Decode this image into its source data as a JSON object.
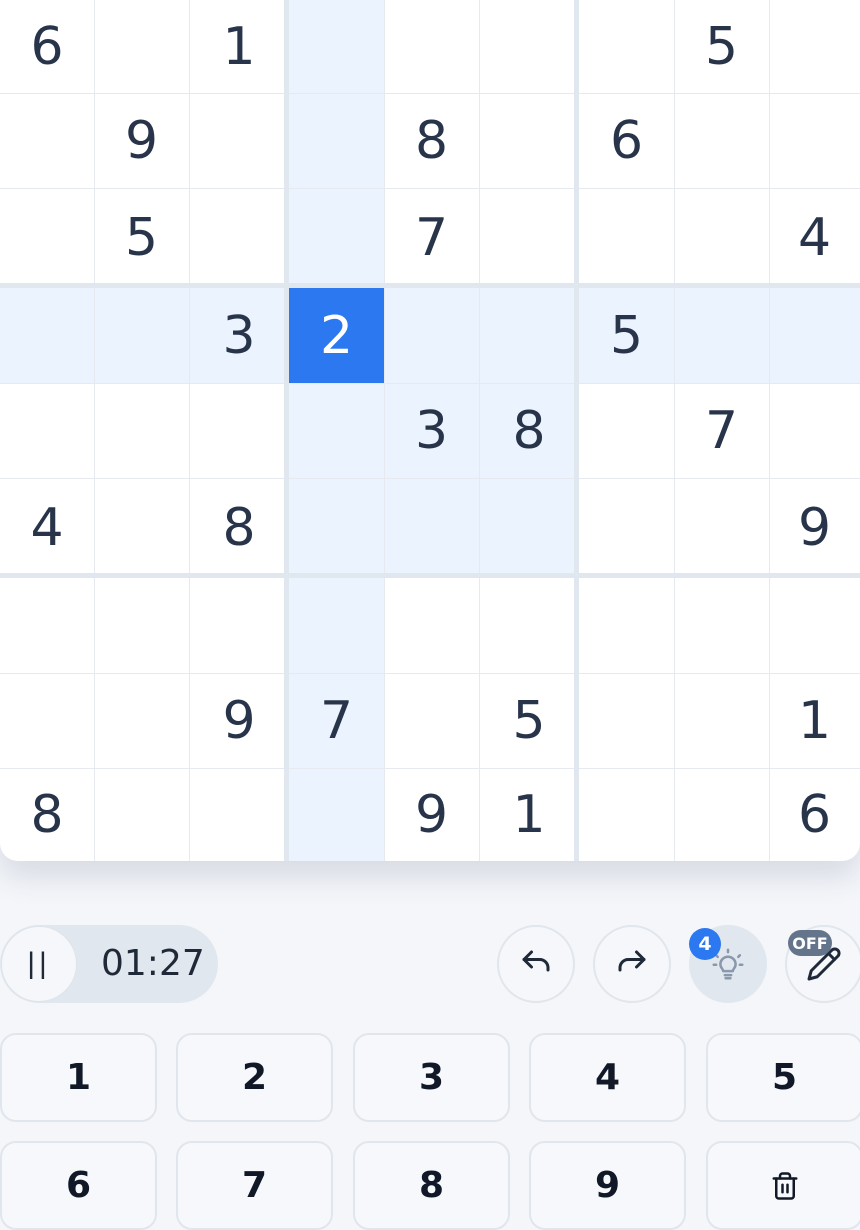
{
  "board": {
    "cells": [
      [
        "6",
        "",
        "1",
        "",
        "",
        "",
        "",
        "5",
        ""
      ],
      [
        "",
        "9",
        "",
        "",
        "8",
        "",
        "6",
        "",
        ""
      ],
      [
        "",
        "5",
        "",
        "",
        "7",
        "",
        "",
        "",
        "4"
      ],
      [
        "",
        "",
        "3",
        "2",
        "",
        "",
        "5",
        "",
        ""
      ],
      [
        "",
        "",
        "",
        "",
        "3",
        "8",
        "",
        "7",
        ""
      ],
      [
        "4",
        "",
        "8",
        "",
        "",
        "",
        "",
        "",
        "9"
      ],
      [
        "",
        "",
        "",
        "",
        "",
        "",
        "",
        "",
        ""
      ],
      [
        "",
        "",
        "9",
        "7",
        "",
        "5",
        "",
        "",
        "1"
      ],
      [
        "8",
        "",
        "",
        "",
        "9",
        "1",
        "",
        "",
        "6"
      ]
    ],
    "selected": {
      "row": 3,
      "col": 3
    }
  },
  "timer": {
    "pause_label": "||",
    "time": "01:27"
  },
  "actions": {
    "undo_icon": "undo-arrow-icon",
    "redo_icon": "redo-arrow-icon",
    "hint_icon": "lightbulb-icon",
    "hint_count": "4",
    "notes_icon": "pencil-icon",
    "notes_state": "OFF"
  },
  "numpad": {
    "keys": [
      "1",
      "2",
      "3",
      "4",
      "5",
      "6",
      "7",
      "8",
      "9"
    ],
    "erase_icon": "trash-icon"
  },
  "colors": {
    "accent": "#2b78f0",
    "highlight": "#ebf3fe",
    "digit": "#28344a",
    "notes_badge": "#64748b"
  }
}
